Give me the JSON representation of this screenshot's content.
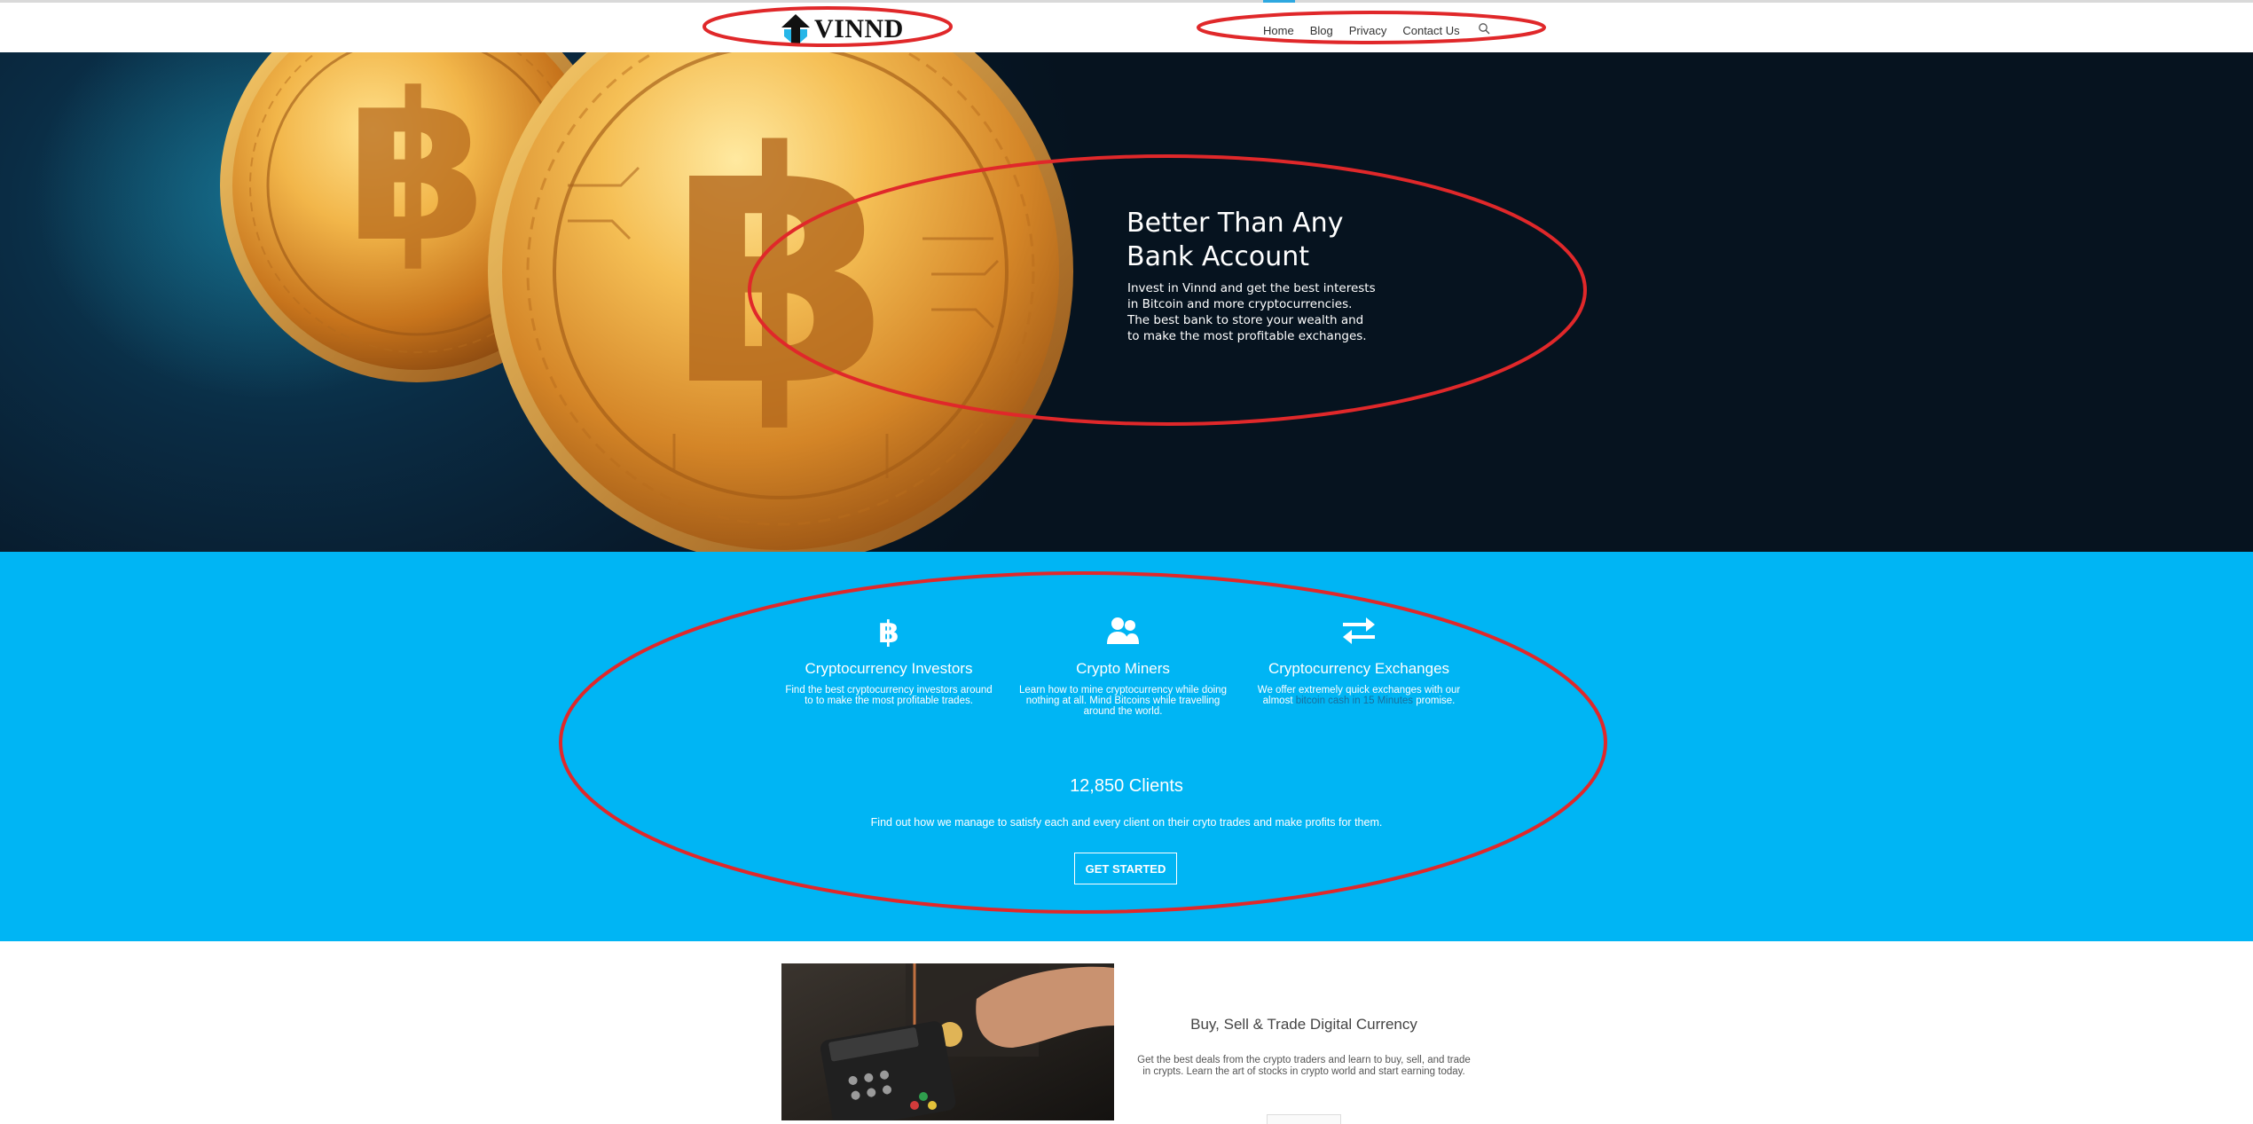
{
  "header": {
    "logo_text": "VINND",
    "nav": [
      "Home",
      "Blog",
      "Privacy",
      "Contact Us"
    ],
    "search_icon": "search-icon"
  },
  "hero": {
    "title_line1": "Better Than Any",
    "title_line2": "Bank Account",
    "text": "Invest in Vinnd and get the best interests in Bitcoin and more cryptocurrencies. The best bank to store your wealth and to make the most profitable exchanges."
  },
  "features": [
    {
      "icon": "bitcoin-icon",
      "title": "Cryptocurrency Investors",
      "text": "Find the best cryptocurrency investors around to to make the most profitable trades."
    },
    {
      "icon": "users-icon",
      "title": "Crypto Miners",
      "text": "Learn how to mine cryptocurrency while doing nothing at all. Mind Bitcoins while travelling around the world."
    },
    {
      "icon": "exchange-icon",
      "title": "Cryptocurrency Exchanges",
      "text_before": "We offer extremely quick exchanges with our almost",
      "text_link": "bitcoin cash in 15 Minutes",
      "text_after": "promise."
    }
  ],
  "clients": {
    "count": "12,850 Clients",
    "text": "Find out how we manage to satisfy each and every client on their cryto trades and make profits for them.",
    "button": "GET STARTED"
  },
  "bottom": {
    "title": "Buy, Sell & Trade Digital Currency",
    "text": "Get the best deals from the crypto traders and learn to buy, sell, and trade in crypts. Learn the art of stocks in crypto world and start earning today."
  },
  "colors": {
    "accent_blue": "#00b5f4",
    "hero_dark": "#081a2b",
    "gold": "#e0a23a",
    "annotation_red": "#e0282a"
  }
}
